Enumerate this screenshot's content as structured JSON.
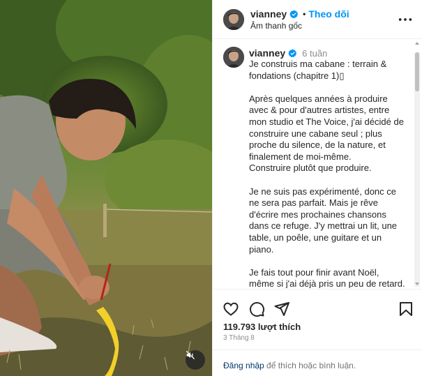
{
  "post": {
    "username": "vianney",
    "follow_label": "Theo dõi",
    "follow_dot": "•",
    "audio_label": "Âm thanh gốc",
    "more_icon": "more-horizontal-icon",
    "caption": {
      "username": "vianney",
      "time_ago": "6 tuần",
      "text": "Je construis ma cabane : terrain & fondations (chapitre 1)▯\n\nAprès quelques années à produire avec & pour d'autres artistes, entre mon studio et The Voice, j'ai décidé de construire une cabane seul ; plus proche du silence, de la nature, et finalement de moi-même.\nConstruire plutôt que produire.\n\nJe ne suis pas expérimenté, donc ce ne sera pas parfait. Mais je rêve d'écrire mes prochaines chansons dans ce refuge. J'y mettrai un lit, une table, un poêle, une guitare et un piano.\n\nJe fais tout pour finir avant Noël, même si j'ai déjà pris un peu de retard.\nVous pensez que j'y arriverai ?"
    },
    "actions": {
      "like_icon": "heart-icon",
      "comment_icon": "comment-icon",
      "share_icon": "share-icon",
      "save_icon": "bookmark-icon"
    },
    "likes_count": "119.793",
    "likes_label": "lượt thích",
    "likes_text": "119.793 lượt thích",
    "date": "3 Tháng 8",
    "login_link": "Đăng nhập",
    "login_suffix": " để thích hoặc bình luận."
  },
  "media": {
    "mute_icon": "volume-muted-icon"
  },
  "colors": {
    "accent": "#0095f6",
    "verified": "#0095f6",
    "link": "#00376b",
    "muted_text": "#8e8e8e"
  }
}
